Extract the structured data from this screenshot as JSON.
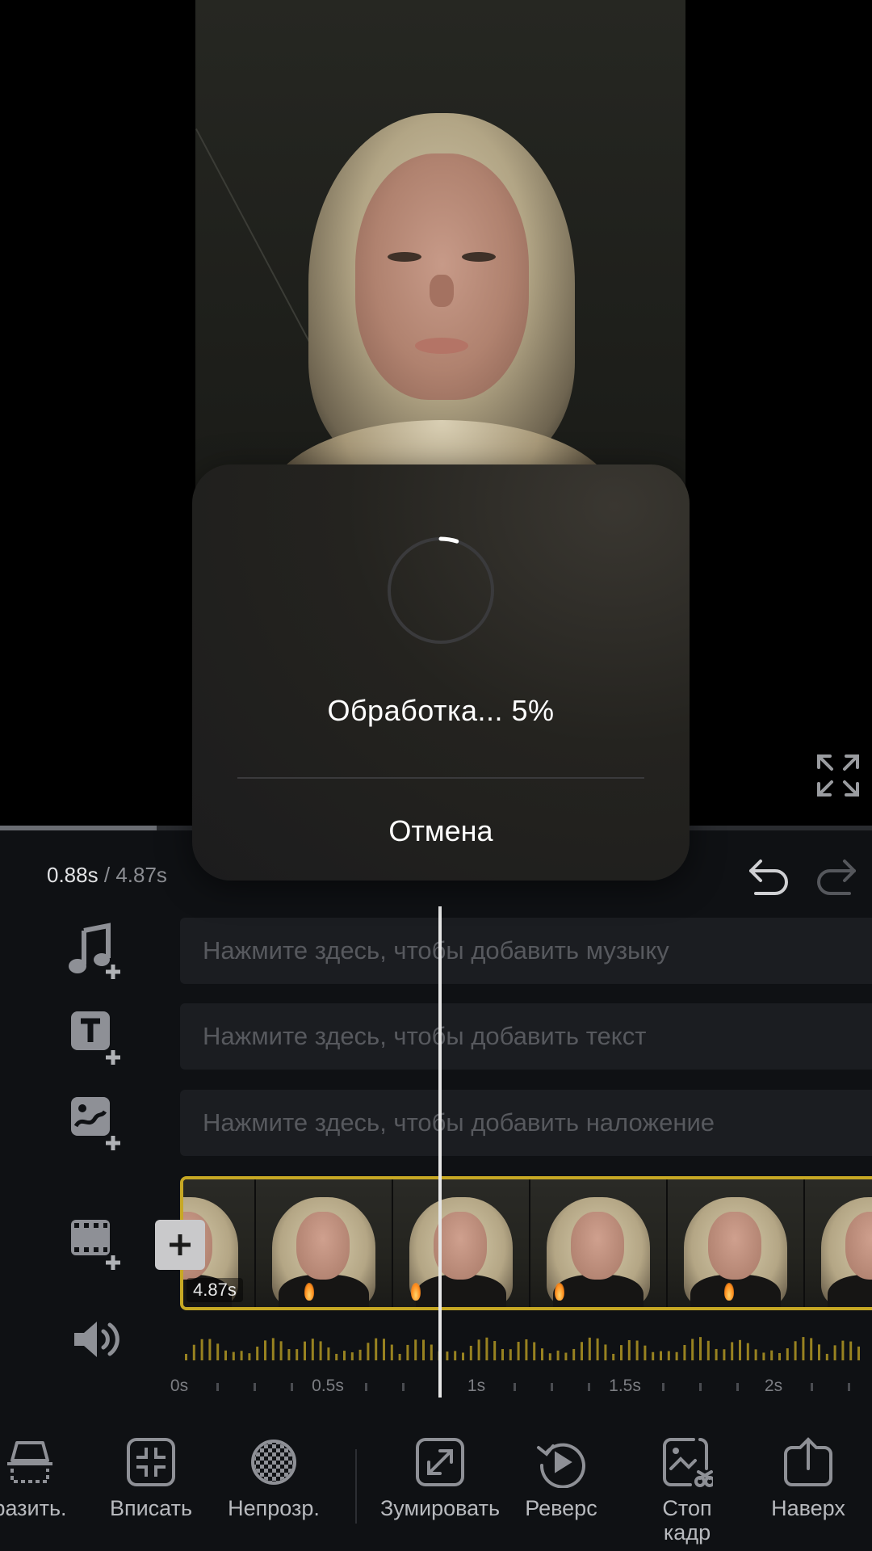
{
  "preview": {
    "progress_fraction": 0.18
  },
  "modal": {
    "processing_text": "Обработка... 5%",
    "progress_percent": 5,
    "cancel_label": "Отмена"
  },
  "timeline": {
    "current_time": "0.88s",
    "separator": "/",
    "total_time": "4.87s",
    "music_placeholder": "Нажмите здесь, чтобы добавить музыку",
    "text_placeholder": "Нажмите здесь, чтобы добавить текст",
    "overlay_placeholder": "Нажмите здесь, чтобы добавить наложение",
    "clip_duration": "4.87s",
    "ruler": [
      "0s",
      "0.5s",
      "1s",
      "1.5s",
      "2s"
    ]
  },
  "toolbar": {
    "items": [
      {
        "label": "разить.",
        "icon": "mirror-icon"
      },
      {
        "label": "Вписать",
        "icon": "fit-icon"
      },
      {
        "label": "Непрозр.",
        "icon": "opacity-icon"
      },
      {
        "label": "Зумировать",
        "icon": "zoom-icon"
      },
      {
        "label": "Реверс",
        "icon": "reverse-icon"
      },
      {
        "label": "Стоп кадр",
        "icon": "freeze-frame-icon"
      },
      {
        "label": "Наверх",
        "icon": "bring-up-icon"
      }
    ]
  },
  "colors": {
    "accent": "#c7a824",
    "background": "#0f1114",
    "track_bg": "#1b1d21"
  }
}
